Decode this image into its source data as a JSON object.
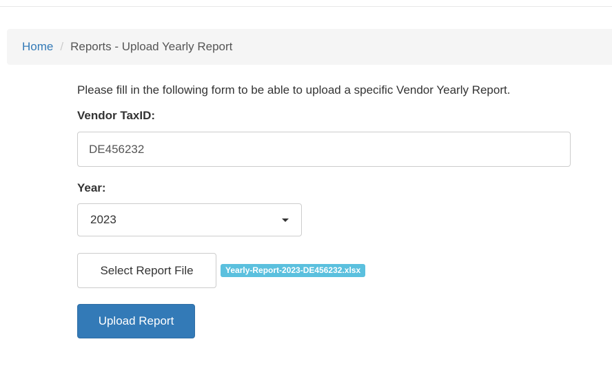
{
  "breadcrumb": {
    "home": "Home",
    "separator": "/",
    "current": "Reports - Upload Yearly Report"
  },
  "form": {
    "intro": "Please fill in the following form to be able to upload a specific Vendor Yearly Report.",
    "vendor_label": "Vendor TaxID:",
    "vendor_value": "DE456232",
    "year_label": "Year:",
    "year_value": "2023",
    "select_file_label": "Select Report File",
    "file_name": "Yearly-Report-2023-DE456232.xlsx",
    "upload_label": "Upload Report"
  },
  "colors": {
    "link": "#337ab7",
    "primary_button": "#337ab7",
    "info_badge": "#5bc0de",
    "breadcrumb_bg": "#f5f5f5"
  },
  "icons": {
    "year_select": "caret-down-icon"
  }
}
